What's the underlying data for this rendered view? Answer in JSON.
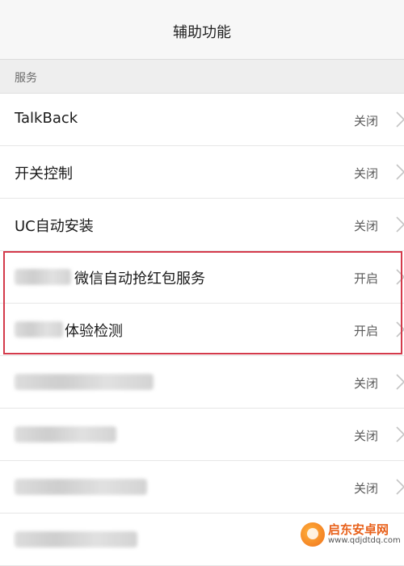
{
  "header": {
    "title": "辅助功能"
  },
  "section": {
    "label": "服务"
  },
  "items": [
    {
      "name": "TalkBack",
      "status": "关闭"
    },
    {
      "name": "开关控制",
      "status": "关闭"
    },
    {
      "name": "UC自动安装",
      "status": "关闭"
    },
    {
      "name": "微信自动抢红包服务",
      "status": "开启"
    },
    {
      "name": "体验检测",
      "status": "开启"
    },
    {
      "name": "",
      "status": "关闭"
    },
    {
      "name": "",
      "status": "关闭"
    },
    {
      "name": "",
      "status": "关闭"
    },
    {
      "name": "",
      "status": ""
    }
  ],
  "watermark": {
    "line1": "启东安卓网",
    "line2": "www.qdjdtdq.com"
  },
  "colors": {
    "highlight": "#d43a4b",
    "accent": "#e8611b"
  }
}
